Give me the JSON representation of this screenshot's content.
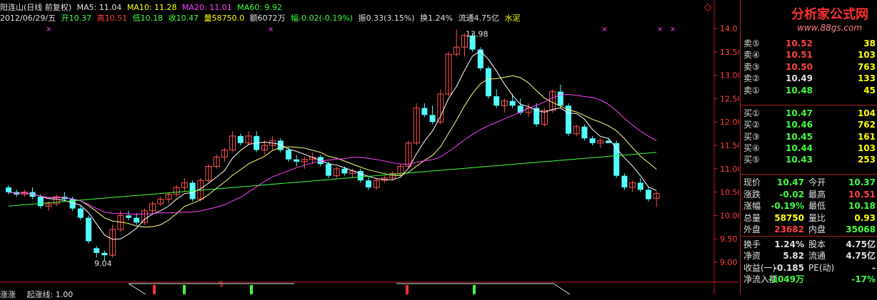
{
  "header": {
    "stock": "阳连山(日线 前复权)",
    "ma5": "MA5: 11.04",
    "ma10": "MA10: 11.28",
    "ma20": "MA20: 11.01",
    "ma60": "MA60: 9.92",
    "date": "2012/06/29/五",
    "open": "开10.37",
    "high": "高10.51",
    "low": "低10.18",
    "close": "收10.47",
    "volume": "量58750.0",
    "amount": "额6072万",
    "change": "幅-0.02(-0.19%)",
    "amplitude": "振0.33(3.15%)",
    "turnover": "换1.24%",
    "float": "流通4.75亿",
    "sector": "水泥"
  },
  "indicator": {
    "name": "涨涨",
    "line_label": "起涨线: 1.00"
  },
  "chart_data": {
    "type": "candlestick",
    "ylim": [
      8.8,
      14.2
    ],
    "y_ticks": [
      "14.0",
      "13.50",
      "13.00",
      "12.50",
      "12.00",
      "11.50",
      "11.00",
      "10.50",
      "10.00",
      "9.50",
      "9.00"
    ],
    "annotations": {
      "high": "13.98",
      "low": "9.04"
    },
    "candles": [
      [
        10.6,
        10.65,
        10.45,
        10.5
      ],
      [
        10.5,
        10.55,
        10.4,
        10.45
      ],
      [
        10.45,
        10.55,
        10.4,
        10.5
      ],
      [
        10.5,
        10.6,
        10.35,
        10.4
      ],
      [
        10.4,
        10.45,
        10.15,
        10.2
      ],
      [
        10.2,
        10.3,
        10.1,
        10.25
      ],
      [
        10.25,
        10.45,
        10.2,
        10.4
      ],
      [
        10.4,
        10.5,
        10.3,
        10.35
      ],
      [
        10.35,
        10.4,
        10.1,
        10.15
      ],
      [
        10.15,
        10.2,
        9.9,
        9.95
      ],
      [
        9.95,
        10.0,
        9.4,
        9.45
      ],
      [
        9.3,
        9.35,
        9.1,
        9.2
      ],
      [
        9.2,
        9.25,
        9.04,
        9.15
      ],
      [
        9.15,
        9.8,
        9.1,
        9.7
      ],
      [
        9.7,
        10.1,
        9.65,
        10.0
      ],
      [
        10.0,
        10.1,
        9.9,
        9.95
      ],
      [
        9.95,
        10.05,
        9.8,
        9.85
      ],
      [
        9.85,
        10.15,
        9.8,
        10.1
      ],
      [
        10.1,
        10.3,
        10.05,
        10.25
      ],
      [
        10.25,
        10.4,
        10.2,
        10.35
      ],
      [
        10.35,
        10.5,
        10.25,
        10.45
      ],
      [
        10.45,
        10.65,
        10.4,
        10.6
      ],
      [
        10.6,
        10.8,
        10.5,
        10.7
      ],
      [
        10.7,
        10.75,
        10.3,
        10.35
      ],
      [
        10.35,
        10.8,
        10.3,
        10.75
      ],
      [
        10.75,
        11.1,
        10.7,
        11.05
      ],
      [
        11.05,
        11.3,
        11.0,
        11.25
      ],
      [
        11.25,
        11.45,
        11.15,
        11.4
      ],
      [
        11.4,
        11.8,
        11.35,
        11.7
      ],
      [
        11.7,
        11.75,
        11.5,
        11.55
      ],
      [
        11.55,
        11.8,
        11.5,
        11.7
      ],
      [
        11.7,
        11.8,
        11.35,
        11.4
      ],
      [
        11.4,
        11.6,
        11.3,
        11.5
      ],
      [
        11.5,
        11.7,
        11.4,
        11.6
      ],
      [
        11.6,
        11.65,
        11.35,
        11.4
      ],
      [
        11.4,
        11.45,
        11.15,
        11.2
      ],
      [
        11.2,
        11.3,
        11.05,
        11.15
      ],
      [
        11.15,
        11.25,
        11.0,
        11.2
      ],
      [
        11.2,
        11.35,
        11.1,
        11.25
      ],
      [
        11.25,
        11.3,
        11.05,
        11.1
      ],
      [
        11.1,
        11.15,
        10.8,
        10.85
      ],
      [
        10.85,
        11.05,
        10.8,
        11.0
      ],
      [
        11.0,
        11.05,
        10.85,
        10.9
      ],
      [
        10.9,
        11.0,
        10.8,
        10.95
      ],
      [
        10.95,
        11.0,
        10.7,
        10.75
      ],
      [
        10.75,
        10.85,
        10.55,
        10.6
      ],
      [
        10.6,
        10.8,
        10.55,
        10.75
      ],
      [
        10.75,
        10.85,
        10.7,
        10.8
      ],
      [
        10.8,
        10.95,
        10.75,
        10.9
      ],
      [
        10.9,
        11.1,
        10.85,
        11.05
      ],
      [
        11.05,
        11.6,
        11.0,
        11.55
      ],
      [
        11.55,
        12.4,
        11.5,
        12.3
      ],
      [
        12.3,
        12.4,
        12.1,
        12.15
      ],
      [
        12.15,
        12.35,
        11.95,
        12.0
      ],
      [
        12.0,
        12.7,
        11.95,
        12.6
      ],
      [
        12.6,
        13.5,
        12.55,
        13.45
      ],
      [
        13.45,
        13.98,
        13.4,
        13.6
      ],
      [
        13.6,
        13.9,
        13.4,
        13.85
      ],
      [
        13.85,
        13.9,
        13.5,
        13.55
      ],
      [
        13.55,
        13.6,
        13.1,
        13.15
      ],
      [
        13.15,
        13.2,
        12.5,
        12.55
      ],
      [
        12.55,
        12.7,
        12.3,
        12.35
      ],
      [
        12.35,
        12.5,
        12.2,
        12.45
      ],
      [
        12.45,
        12.6,
        12.3,
        12.35
      ],
      [
        12.35,
        12.5,
        12.15,
        12.2
      ],
      [
        12.2,
        12.4,
        12.1,
        12.3
      ],
      [
        12.3,
        12.4,
        11.9,
        11.95
      ],
      [
        11.95,
        12.3,
        11.9,
        12.25
      ],
      [
        12.25,
        12.7,
        12.2,
        12.65
      ],
      [
        12.65,
        12.8,
        12.3,
        12.35
      ],
      [
        12.35,
        12.4,
        11.7,
        11.75
      ],
      [
        11.75,
        11.95,
        11.7,
        11.9
      ],
      [
        11.9,
        11.95,
        11.6,
        11.65
      ],
      [
        11.65,
        11.7,
        11.5,
        11.55
      ],
      [
        11.55,
        11.65,
        11.45,
        11.6
      ],
      [
        11.6,
        11.65,
        11.55,
        11.55
      ],
      [
        11.55,
        11.6,
        10.8,
        10.85
      ],
      [
        10.85,
        10.9,
        10.55,
        10.6
      ],
      [
        10.6,
        10.75,
        10.5,
        10.7
      ],
      [
        10.7,
        10.8,
        10.5,
        10.55
      ],
      [
        10.55,
        10.6,
        10.3,
        10.35
      ],
      [
        10.37,
        10.51,
        10.18,
        10.47
      ]
    ],
    "ma_colors": {
      "ma5": "#ffffff",
      "ma10": "#ffff80",
      "ma20": "#ff44ff",
      "ma60": "#40ff40"
    }
  },
  "order_book": {
    "sells": [
      {
        "label": "卖⑤",
        "price": "10.52",
        "vol": "38"
      },
      {
        "label": "卖④",
        "price": "10.51",
        "vol": "103"
      },
      {
        "label": "卖③",
        "price": "10.50",
        "vol": "763"
      },
      {
        "label": "卖②",
        "price": "10.49",
        "vol": "133"
      },
      {
        "label": "卖①",
        "price": "10.48",
        "vol": "45"
      }
    ],
    "buys": [
      {
        "label": "买①",
        "price": "10.47",
        "vol": "104"
      },
      {
        "label": "买②",
        "price": "10.46",
        "vol": "762"
      },
      {
        "label": "买③",
        "price": "10.45",
        "vol": "161"
      },
      {
        "label": "买④",
        "price": "10.44",
        "vol": "103"
      },
      {
        "label": "买⑤",
        "price": "10.43",
        "vol": "253"
      }
    ]
  },
  "quote": [
    {
      "l1": "现价",
      "v1": "10.47",
      "c1": "#40ff40",
      "l2": "今开",
      "v2": "10.37",
      "c2": "#40ff40"
    },
    {
      "l1": "涨跌",
      "v1": "-0.02",
      "c1": "#40ff40",
      "l2": "最高",
      "v2": "10.51",
      "c2": "#ff4040"
    },
    {
      "l1": "涨幅",
      "v1": "-0.19%",
      "c1": "#40ff40",
      "l2": "最低",
      "v2": "10.18",
      "c2": "#40ff40"
    },
    {
      "l1": "总量",
      "v1": "58750",
      "c1": "#ffff00",
      "l2": "量比",
      "v2": "0.93",
      "c2": "#ffff00"
    },
    {
      "l1": "外盘",
      "v1": "23682",
      "c1": "#ff4040",
      "l2": "内盘",
      "v2": "35068",
      "c2": "#40ff40"
    },
    {
      "l1": "换手",
      "v1": "1.24%",
      "c1": "#e0e0e0",
      "l2": "股本",
      "v2": "4.75亿",
      "c2": "#e0e0e0"
    },
    {
      "l1": "净资",
      "v1": "5.82",
      "c1": "#e0e0e0",
      "l2": "流通",
      "v2": "4.75亿",
      "c2": "#e0e0e0"
    },
    {
      "l1": "收益(一)",
      "v1": "-0.185",
      "c1": "#e0e0e0",
      "l2": "PE(动)",
      "v2": "-",
      "c2": "#e0e0e0"
    },
    {
      "l1": "净流入额",
      "v1": "-1049万",
      "c1": "#40ff40",
      "l2": "",
      "v2": "-17%",
      "c2": "#40ff40"
    }
  ],
  "logo": {
    "title": "分析家公式网",
    "url": "www.88gs.com"
  }
}
